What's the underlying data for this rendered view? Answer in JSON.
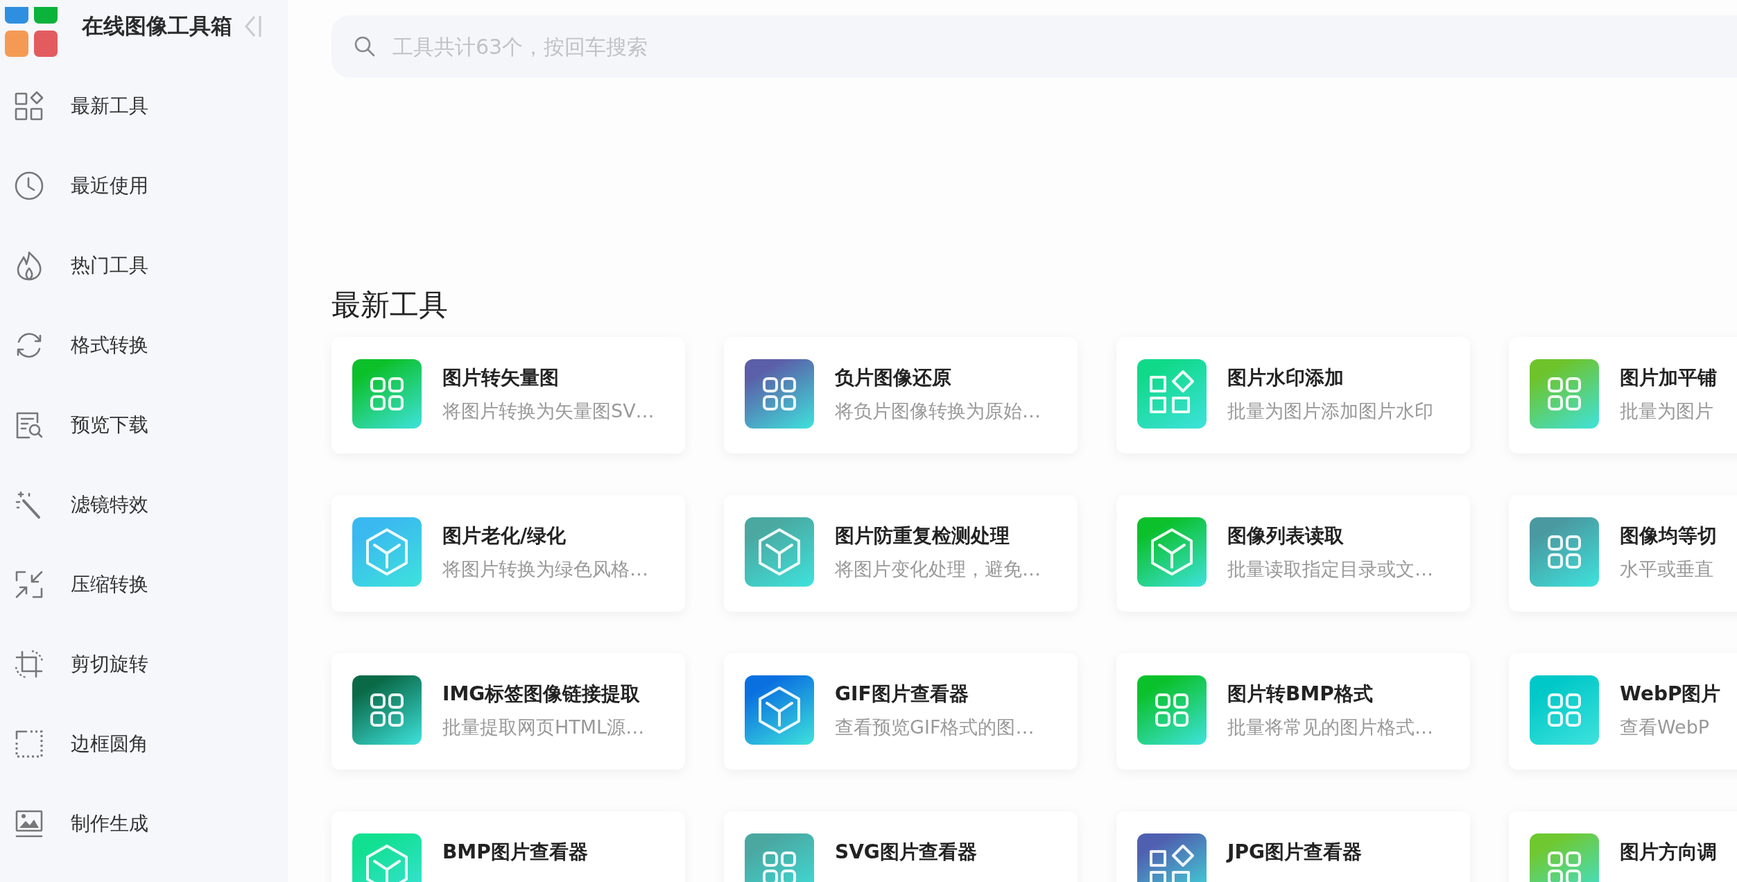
{
  "sidebar": {
    "title": "在线图像工具箱",
    "items": [
      {
        "label": "最新工具"
      },
      {
        "label": "最近使用"
      },
      {
        "label": "热门工具"
      },
      {
        "label": "格式转换"
      },
      {
        "label": "预览下载"
      },
      {
        "label": "滤镜特效"
      },
      {
        "label": "压缩转换"
      },
      {
        "label": "剪切旋转"
      },
      {
        "label": "边框圆角"
      },
      {
        "label": "制作生成"
      }
    ]
  },
  "search": {
    "placeholder": "工具共计63个，按回车搜索"
  },
  "section": {
    "title": "最新工具",
    "cards": [
      {
        "title": "图片转矢量图",
        "description": "将图片转换为矢量图SV…",
        "kind": "grid",
        "color": "#0cc02a"
      },
      {
        "title": "负片图像还原",
        "description": "将负片图像转换为原始…",
        "kind": "grid",
        "color": "#5b5ea8"
      },
      {
        "title": "图片水印添加",
        "description": "批量为图片添加图片水印",
        "kind": "shapes",
        "color": "#11d98a"
      },
      {
        "title": "图片加平铺",
        "description": "批量为图片",
        "kind": "grid",
        "color": "#6ec32a"
      },
      {
        "title": "图片老化/绿化",
        "description": "将图片转换为绿色风格…",
        "kind": "cube",
        "color": "#3ab8f0"
      },
      {
        "title": "图片防重复检测处理",
        "description": "将图片变化处理，避免…",
        "kind": "cube",
        "color": "#4aa8a0"
      },
      {
        "title": "图像列表读取",
        "description": "批量读取指定目录或文…",
        "kind": "cube",
        "color": "#0bc02a"
      },
      {
        "title": "图像均等切",
        "description": "水平或垂直",
        "kind": "grid",
        "color": "#4a98a0"
      },
      {
        "title": "IMG标签图像链接提取",
        "description": "批量提取网页HTML源…",
        "kind": "grid",
        "color": "#0a6a48"
      },
      {
        "title": "GIF图片查看器",
        "description": "查看预览GIF格式的图…",
        "kind": "cube",
        "color": "#0a70e0"
      },
      {
        "title": "图片转BMP格式",
        "description": "批量将常见的图片格式…",
        "kind": "grid",
        "color": "#0bc12b"
      },
      {
        "title": "WebP图片",
        "description": "查看WebP",
        "kind": "grid",
        "color": "#00c8c8"
      },
      {
        "title": "BMP图片查看器",
        "kind": "cube",
        "color": "#10e090"
      },
      {
        "title": "SVG图片查看器",
        "kind": "grid",
        "color": "#4aa8a1"
      },
      {
        "title": "JPG图片查看器",
        "kind": "shapes",
        "color": "#5060b0"
      },
      {
        "title": "图片方向调",
        "kind": "grid",
        "color": "#70c830"
      }
    ]
  }
}
